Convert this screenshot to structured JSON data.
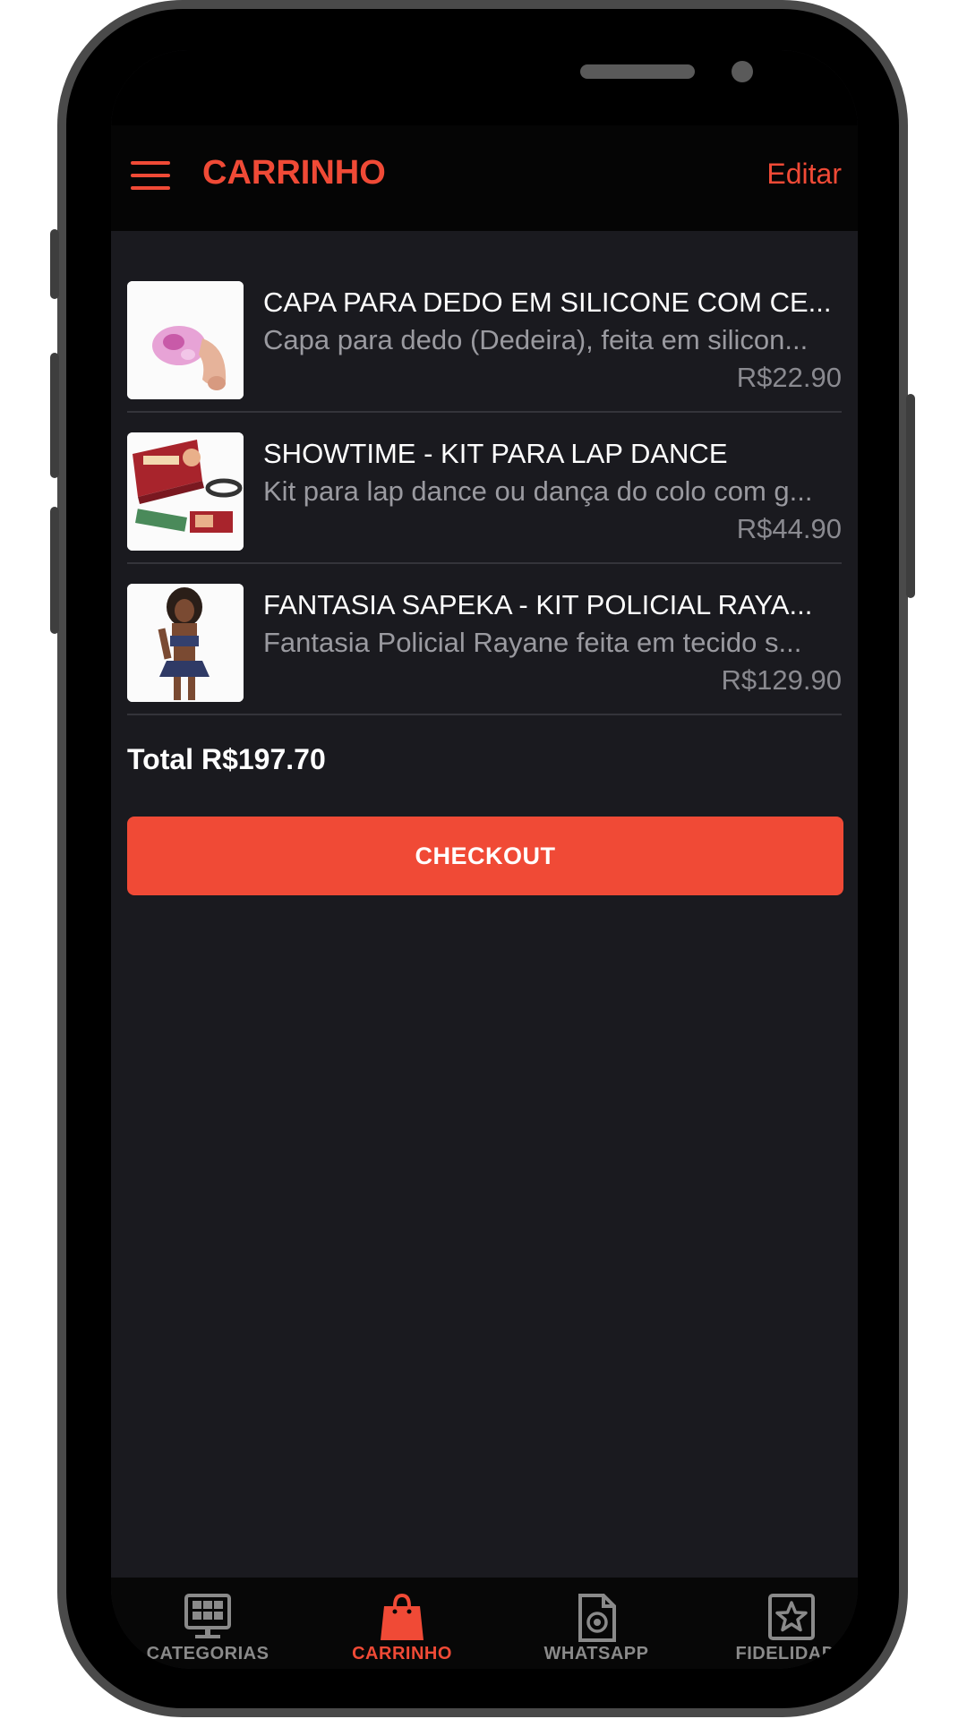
{
  "colors": {
    "accent": "#f04a36",
    "background": "#1a1a1f",
    "header_background": "#050505",
    "text_primary": "#ffffff",
    "text_secondary": "#9a9aa0"
  },
  "header": {
    "menu_icon": "hamburger-menu-icon",
    "title": "CARRINHO",
    "edit_label": "Editar"
  },
  "cart": {
    "items": [
      {
        "name": "CAPA PARA DEDO EM SILICONE COM CE...",
        "description": "Capa para dedo (Dedeira), feita em silicon...",
        "price": "R$22.90"
      },
      {
        "name": "SHOWTIME - KIT PARA LAP DANCE",
        "description": "Kit para lap dance ou dança do colo com g...",
        "price": "R$44.90"
      },
      {
        "name": "FANTASIA SAPEKA - KIT POLICIAL RAYA...",
        "description": "Fantasia Policial Rayane feita em tecido s...",
        "price": "R$129.90"
      }
    ],
    "total": "Total R$197.70",
    "checkout_label": "CHECKOUT"
  },
  "tabs": [
    {
      "label": "CATEGORIAS",
      "icon": "categories-monitor-icon",
      "active": false
    },
    {
      "label": "CARRINHO",
      "icon": "shopping-bag-icon",
      "active": true
    },
    {
      "label": "WHATSAPP",
      "icon": "document-camera-icon",
      "active": false
    },
    {
      "label": "FIDELIDADE",
      "icon": "star-badge-icon",
      "active": false
    }
  ]
}
